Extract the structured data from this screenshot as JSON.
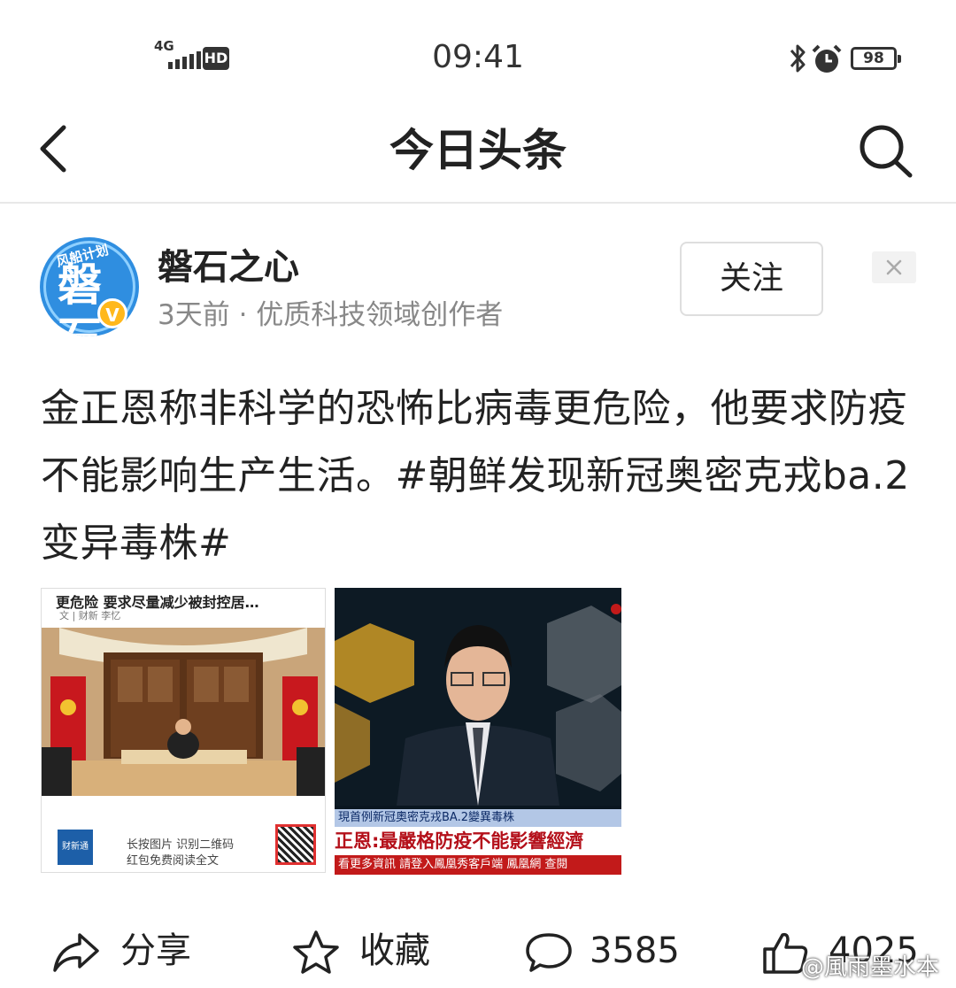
{
  "status_bar": {
    "network": "4G",
    "hd": "HD",
    "time": "09:41",
    "battery": "98"
  },
  "nav": {
    "title": "今日头条"
  },
  "author": {
    "name": "磐石之心",
    "meta": "3天前 · 优质科技领域创作者",
    "avatar_tag": "风船计划",
    "avatar_text": "磐石",
    "verified": "V"
  },
  "follow_label": "关注",
  "post": {
    "text": "金正恩称非科学的恐怖比病毒更危险，他要求防疫不能影响生产生活。#朝鲜发现新冠奥密克戎ba.2变异毒株#"
  },
  "image_left": {
    "headline": "更危险 要求尽量减少被封控居…",
    "byline": "文 | 财新 李忆",
    "logo": "财新通",
    "promo_line1": "长按图片  识别二维码",
    "promo_line2": "红包免费阅读全文"
  },
  "image_right": {
    "ticker_top": "現首例新冠奧密克戎BA.2變異毒株",
    "ticker_main": "正恩:最嚴格防疫不能影響經濟",
    "ticker_bottom": "看更多資訊  請登入鳳凰秀客戶端  鳳凰網  查閱"
  },
  "actions": {
    "share": "分享",
    "favorite": "收藏",
    "comments": "3585",
    "likes": "4025"
  },
  "watermark": "@風雨墨水本",
  "colors": {
    "brand_blue": "#2f8ee0",
    "badge_gold": "#ffb81c",
    "news_red": "#b4101a"
  }
}
